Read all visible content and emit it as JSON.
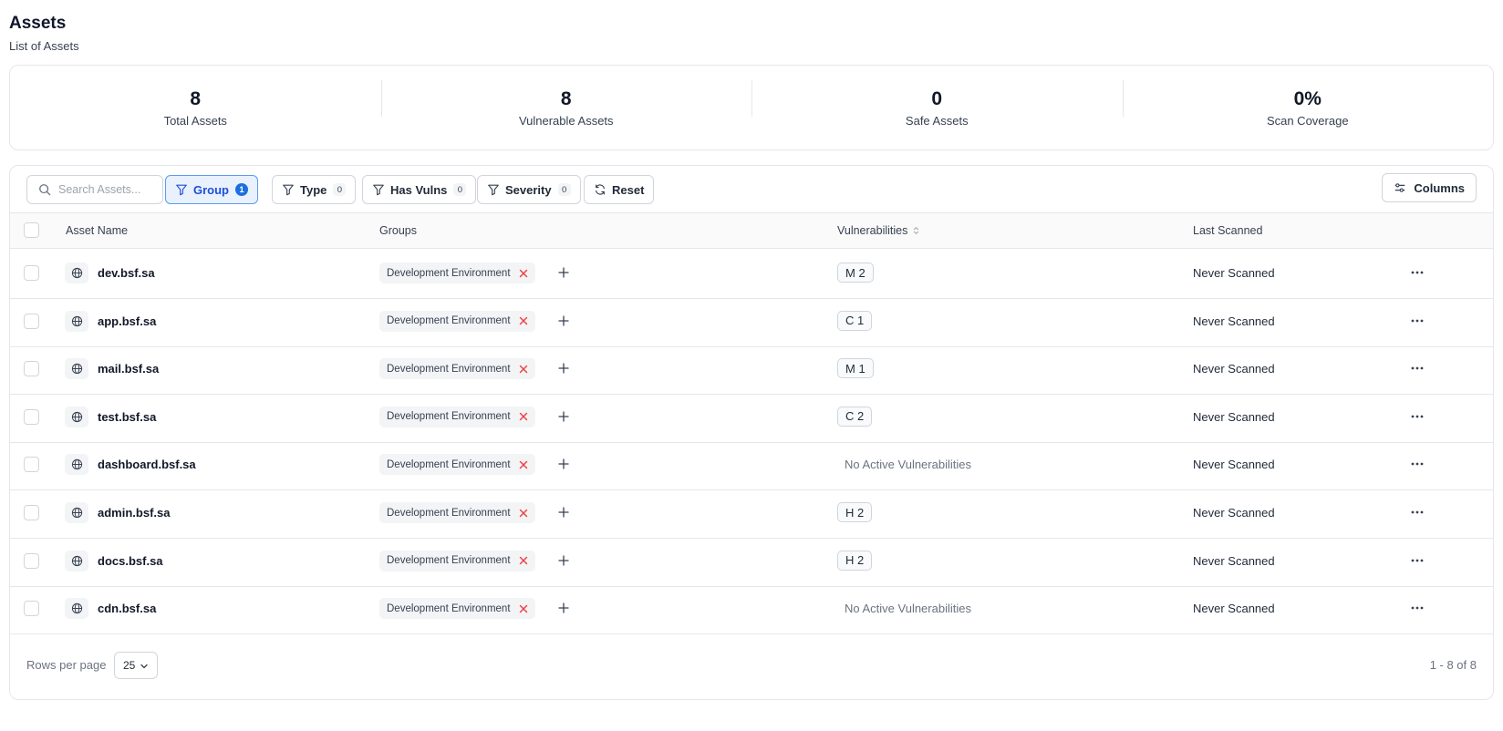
{
  "page": {
    "title": "Assets",
    "subtitle": "List of Assets"
  },
  "stats": [
    {
      "value": "8",
      "label": "Total Assets"
    },
    {
      "value": "8",
      "label": "Vulnerable Assets"
    },
    {
      "value": "0",
      "label": "Safe Assets"
    },
    {
      "value": "0%",
      "label": "Scan Coverage"
    }
  ],
  "toolbar": {
    "search_placeholder": "Search Assets...",
    "filters": [
      {
        "label": "Group",
        "count": "1",
        "active": true
      },
      {
        "label": "Type",
        "count": "0",
        "active": false
      },
      {
        "label": "Has Vulns",
        "count": "0",
        "active": false
      },
      {
        "label": "Severity",
        "count": "0",
        "active": false
      }
    ],
    "reset_label": "Reset",
    "columns_label": "Columns"
  },
  "table": {
    "headers": {
      "asset_name": "Asset Name",
      "groups": "Groups",
      "vulnerabilities": "Vulnerabilities",
      "last_scanned": "Last Scanned"
    },
    "rows": [
      {
        "name": "dev.bsf.sa",
        "group": "Development Environment",
        "vuln": "M 2",
        "last_scanned": "Never Scanned"
      },
      {
        "name": "app.bsf.sa",
        "group": "Development Environment",
        "vuln": "C 1",
        "last_scanned": "Never Scanned"
      },
      {
        "name": "mail.bsf.sa",
        "group": "Development Environment",
        "vuln": "M 1",
        "last_scanned": "Never Scanned"
      },
      {
        "name": "test.bsf.sa",
        "group": "Development Environment",
        "vuln": "C 2",
        "last_scanned": "Never Scanned"
      },
      {
        "name": "dashboard.bsf.sa",
        "group": "Development Environment",
        "vuln": null,
        "vuln_text": "No Active Vulnerabilities",
        "last_scanned": "Never Scanned"
      },
      {
        "name": "admin.bsf.sa",
        "group": "Development Environment",
        "vuln": "H 2",
        "last_scanned": "Never Scanned"
      },
      {
        "name": "docs.bsf.sa",
        "group": "Development Environment",
        "vuln": "H 2",
        "last_scanned": "Never Scanned"
      },
      {
        "name": "cdn.bsf.sa",
        "group": "Development Environment",
        "vuln": null,
        "vuln_text": "No Active Vulnerabilities",
        "last_scanned": "Never Scanned"
      }
    ]
  },
  "footer": {
    "rows_per_page_label": "Rows per page",
    "rows_per_page": "25",
    "pagination": "1 - 8 of 8"
  },
  "colors": {
    "accent": "#1d6fe0",
    "remove_icon": "#ef4444",
    "border": "#e5e7eb"
  },
  "icons": {
    "search": "search-icon",
    "filter": "filter-icon",
    "reset": "refresh-icon",
    "columns": "sliders-icon",
    "asset": "globe-icon",
    "remove": "close-icon",
    "add": "plus-icon",
    "menu": "more-horizontal-icon",
    "sort": "sort-icon",
    "dropdown": "chevron-down-icon"
  }
}
